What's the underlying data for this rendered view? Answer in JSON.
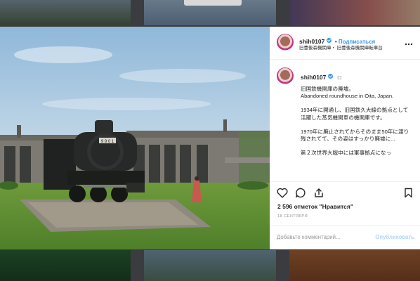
{
  "post": {
    "header": {
      "username": "shih0107",
      "follow_label": "Подписаться",
      "location": "旧豊後森機関庫・ 旧豊後森機関庫転車台",
      "more_label": "⋯"
    },
    "caption": {
      "username": "shih0107",
      "suffix": "□",
      "paragraphs": [
        "旧国鉄機関庫の廃墟。\nAbandoned roundhouse in Oita, Japan.",
        "1934年に開通し、旧国鉄久大線の拠点として活躍した蒸気機関車の機関庫です。",
        "1970年に廃止されてからそのまま50年に渡り残されてて、その姿はすっかり廃墟に...",
        "第２次世界大戦中には軍事拠点になっ"
      ]
    },
    "likes": "2 596 отметок \"Нравится\"",
    "date": "18 СЕНТЯБРЯ",
    "comment_placeholder": "Добавьте комментарий...",
    "post_button": "Опубликовать"
  },
  "photo": {
    "plate": "9 9 0 1"
  },
  "icons": {
    "more": "more-dots-icon",
    "like": "heart-icon",
    "comment": "comment-icon",
    "share": "share-icon",
    "save": "bookmark-icon"
  },
  "colors": {
    "link": "#3897f0",
    "text": "#262626",
    "muted": "#999999",
    "post_button": "#b3d7f9"
  }
}
